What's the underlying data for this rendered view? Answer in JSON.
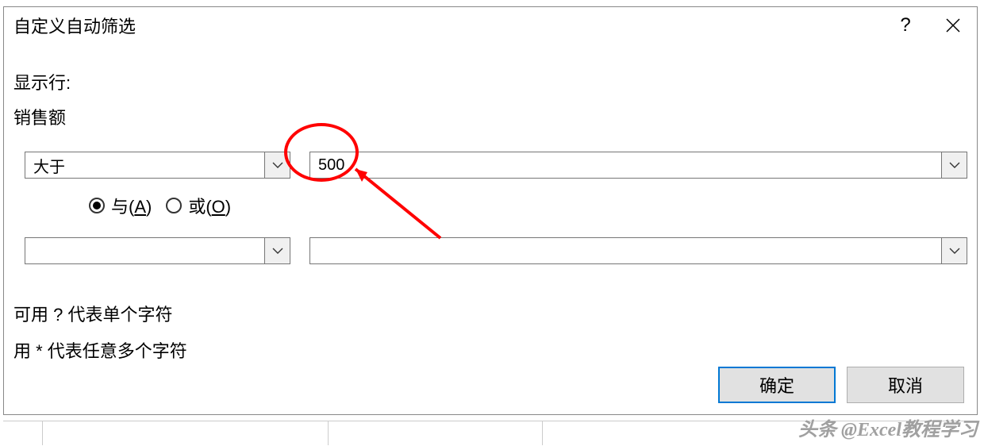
{
  "dialog": {
    "title": "自定义自动筛选",
    "help_icon": "?",
    "close_icon": "×"
  },
  "labels": {
    "show_rows": "显示行:",
    "field_name": "销售额"
  },
  "criteria": {
    "row1": {
      "operator": "大于",
      "value": "500"
    },
    "logic": {
      "and_label": "与(",
      "and_key": "A",
      "and_close": ")",
      "or_label": "或(",
      "or_key": "O",
      "or_close": ")",
      "selected": "and"
    },
    "row2": {
      "operator": "",
      "value": ""
    }
  },
  "hints": {
    "single": "可用 ? 代表单个字符",
    "multi": "用 * 代表任意多个字符"
  },
  "buttons": {
    "ok": "确定",
    "cancel": "取消"
  },
  "watermark": "头条 @Excel教程学习"
}
